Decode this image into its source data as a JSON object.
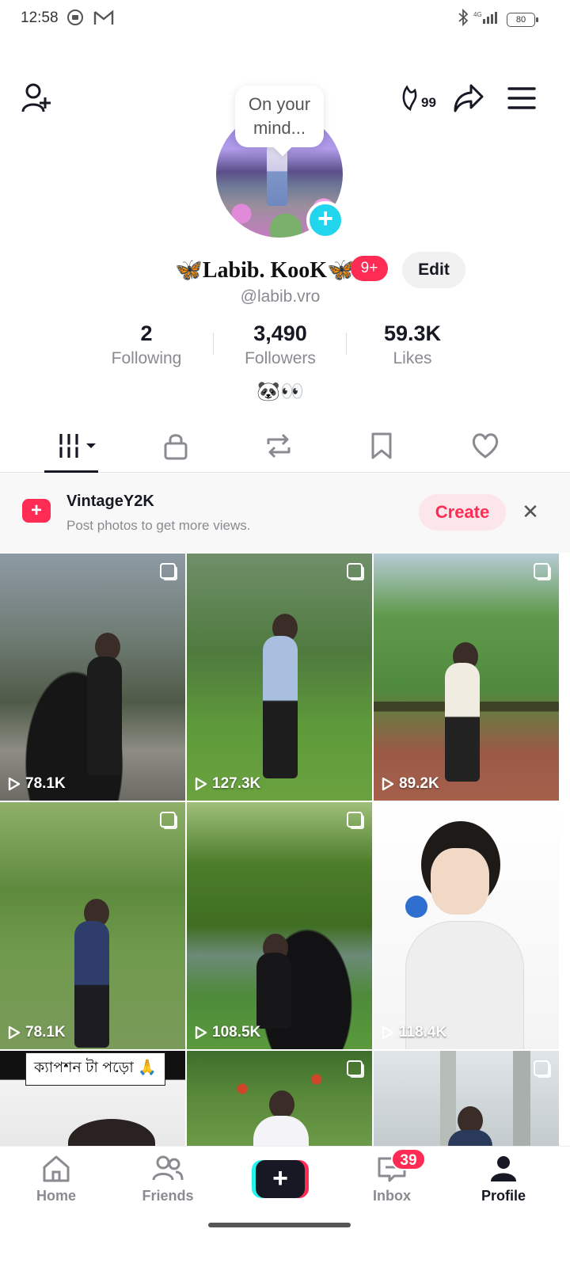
{
  "status_bar": {
    "time": "12:58",
    "battery": "80",
    "network": "4G"
  },
  "header": {
    "bubble_text": "On your mind...",
    "streak_count": "99"
  },
  "profile": {
    "display_name": "🦋Labib. KooK🦋",
    "notification_badge": "9+",
    "edit_label": "Edit",
    "username": "@labib.vro",
    "bio": "🐼👀"
  },
  "stats": [
    {
      "value": "2",
      "label": "Following"
    },
    {
      "value": "3,490",
      "label": "Followers"
    },
    {
      "value": "59.3K",
      "label": "Likes"
    }
  ],
  "tabs": [
    "videos-icon",
    "lock-icon",
    "repost-icon",
    "bookmark-icon",
    "heart-icon"
  ],
  "promo": {
    "title": "VintageY2K",
    "subtitle": "Post photos to get more views.",
    "create_label": "Create"
  },
  "grid": {
    "views": [
      "78.1K",
      "127.3K",
      "89.2K",
      "78.1K",
      "108.5K",
      "118.4K"
    ],
    "caption": "ক্যাপশন টা পড়ো 🙏"
  },
  "bottom_nav": {
    "items": [
      {
        "label": "Home"
      },
      {
        "label": "Friends"
      },
      {
        "label": ""
      },
      {
        "label": "Inbox"
      },
      {
        "label": "Profile"
      }
    ],
    "inbox_badge": "39"
  },
  "colors": {
    "accent": "#fe2c55",
    "cyan": "#20d5ec",
    "text": "#161823",
    "muted": "#8a8b91"
  }
}
